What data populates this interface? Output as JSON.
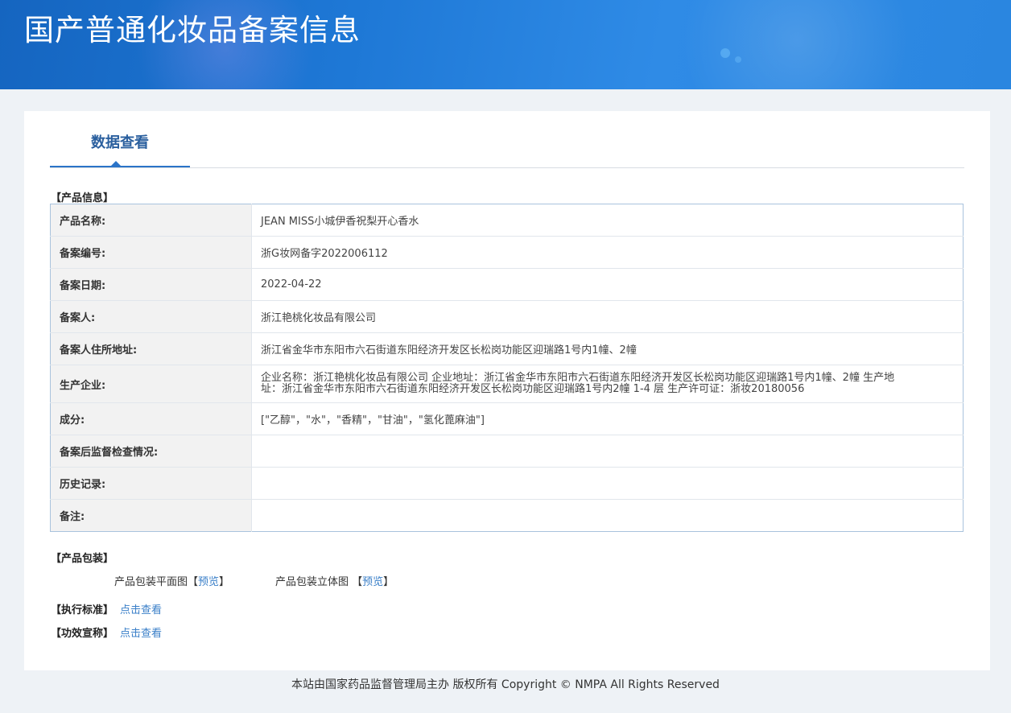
{
  "header": {
    "title": "国产普通化妆品备案信息"
  },
  "tabs": [
    {
      "label": "数据查看"
    }
  ],
  "product_info": {
    "section_label": "【产品信息】",
    "rows": [
      {
        "label": "产品名称:",
        "value": "JEAN MISS小城伊香祝梨开心香水"
      },
      {
        "label": "备案编号:",
        "value": "浙G妆网备字2022006112"
      },
      {
        "label": "备案日期:",
        "value": "2022-04-22"
      },
      {
        "label": "备案人:",
        "value": "浙江艳桃化妆品有限公司"
      },
      {
        "label": "备案人住所地址:",
        "value": "浙江省金华市东阳市六石街道东阳经济开发区长松岗功能区迎瑞路1号内1幢、2幢"
      },
      {
        "label": "生产企业:",
        "value": "企业名称：浙江艳桃化妆品有限公司 企业地址：浙江省金华市东阳市六石街道东阳经济开发区长松岗功能区迎瑞路1号内1幢、2幢 生产地址：浙江省金华市东阳市六石街道东阳经济开发区长松岗功能区迎瑞路1号内2幢 1-4 层 生产许可证：浙妆20180056"
      },
      {
        "label": "成分:",
        "value": "[\"乙醇\"，\"水\"，\"香精\"，\"甘油\"，\"氢化蓖麻油\"]"
      },
      {
        "label": "备案后监督检查情况:",
        "value": ""
      },
      {
        "label": "历史记录:",
        "value": ""
      },
      {
        "label": "备注:",
        "value": ""
      }
    ]
  },
  "packaging": {
    "section_label": "【产品包装】",
    "flat_label": "产品包装平面图",
    "flat_bracket_open": "【",
    "flat_link": "预览",
    "flat_bracket_close": "】",
    "solid_label": "产品包装立体图 ",
    "solid_bracket_open": "【",
    "solid_link": "预览",
    "solid_bracket_close": "】"
  },
  "standards": {
    "label": "【执行标准】",
    "link": "点击查看"
  },
  "efficacy": {
    "label": "【功效宣称】",
    "link": "点击查看"
  },
  "footer": {
    "text": "本站由国家药品监督管理局主办 版权所有 Copyright © NMPA All Rights Reserved"
  }
}
